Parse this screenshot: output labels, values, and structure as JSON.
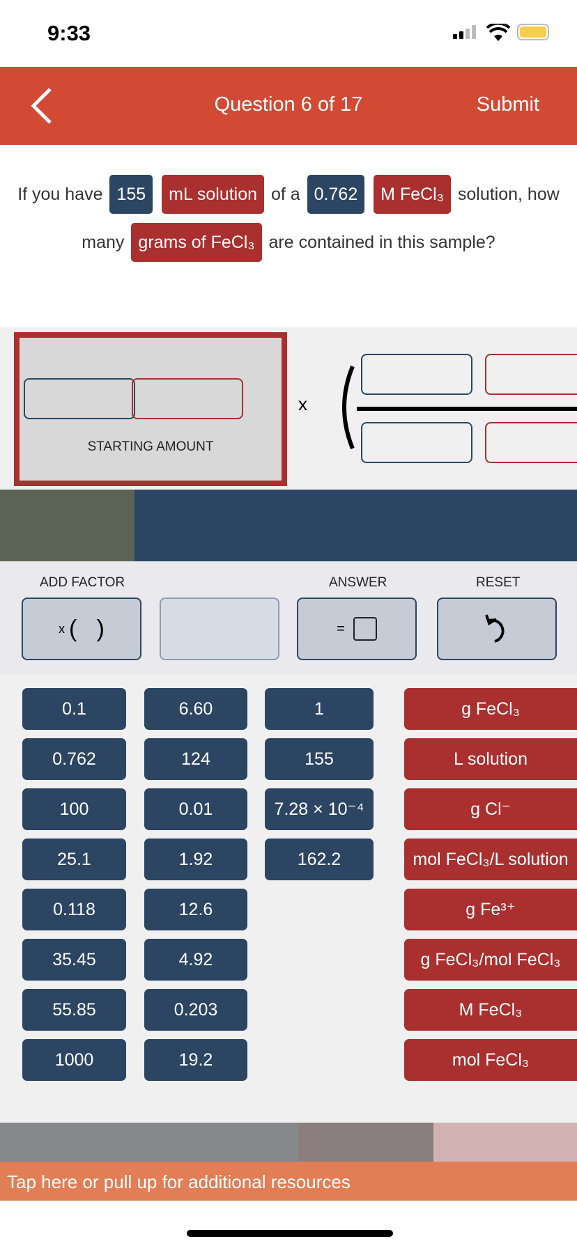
{
  "status": {
    "time": "9:33"
  },
  "header": {
    "title": "Question 6 of 17",
    "submit": "Submit"
  },
  "question": {
    "p1": "If you have",
    "v1": "155",
    "u1": "mL solution",
    "p2": "of a",
    "v2": "0.762",
    "u2": "M FeCl₃",
    "p3": "solution, how many",
    "u3": "grams of  FeCl₃",
    "p4": "are contained in this sample?"
  },
  "work": {
    "multiply": "x",
    "starting_label": "STARTING AMOUNT"
  },
  "tools": {
    "add_factor": "ADD FACTOR",
    "factor_symbol": "x",
    "answer": "ANSWER",
    "equals": "=",
    "reset": "RESET"
  },
  "number_buttons": [
    [
      "0.1",
      "0.762",
      "100",
      "25.1",
      "0.118",
      "35.45",
      "55.85",
      "1000"
    ],
    [
      "6.60",
      "124",
      "0.01",
      "1.92",
      "12.6",
      "4.92",
      "0.203",
      "19.2"
    ],
    [
      "1",
      "155",
      "7.28 × 10⁻⁴",
      "162.2"
    ]
  ],
  "unit_buttons": [
    "g FeCl₃",
    "L solution",
    "g Cl⁻",
    "mol FeCl₃/L solution",
    "g Fe³⁺",
    "g FeCl₃/mol FeCl₃",
    "M FeCl₃",
    "mol FeCl₃"
  ],
  "resources": "Tap here or pull up for additional resources",
  "colors": {
    "header": "#d24a34",
    "blue": "#2b4563",
    "red": "#aa2f2f",
    "resources": "#e17e56"
  }
}
